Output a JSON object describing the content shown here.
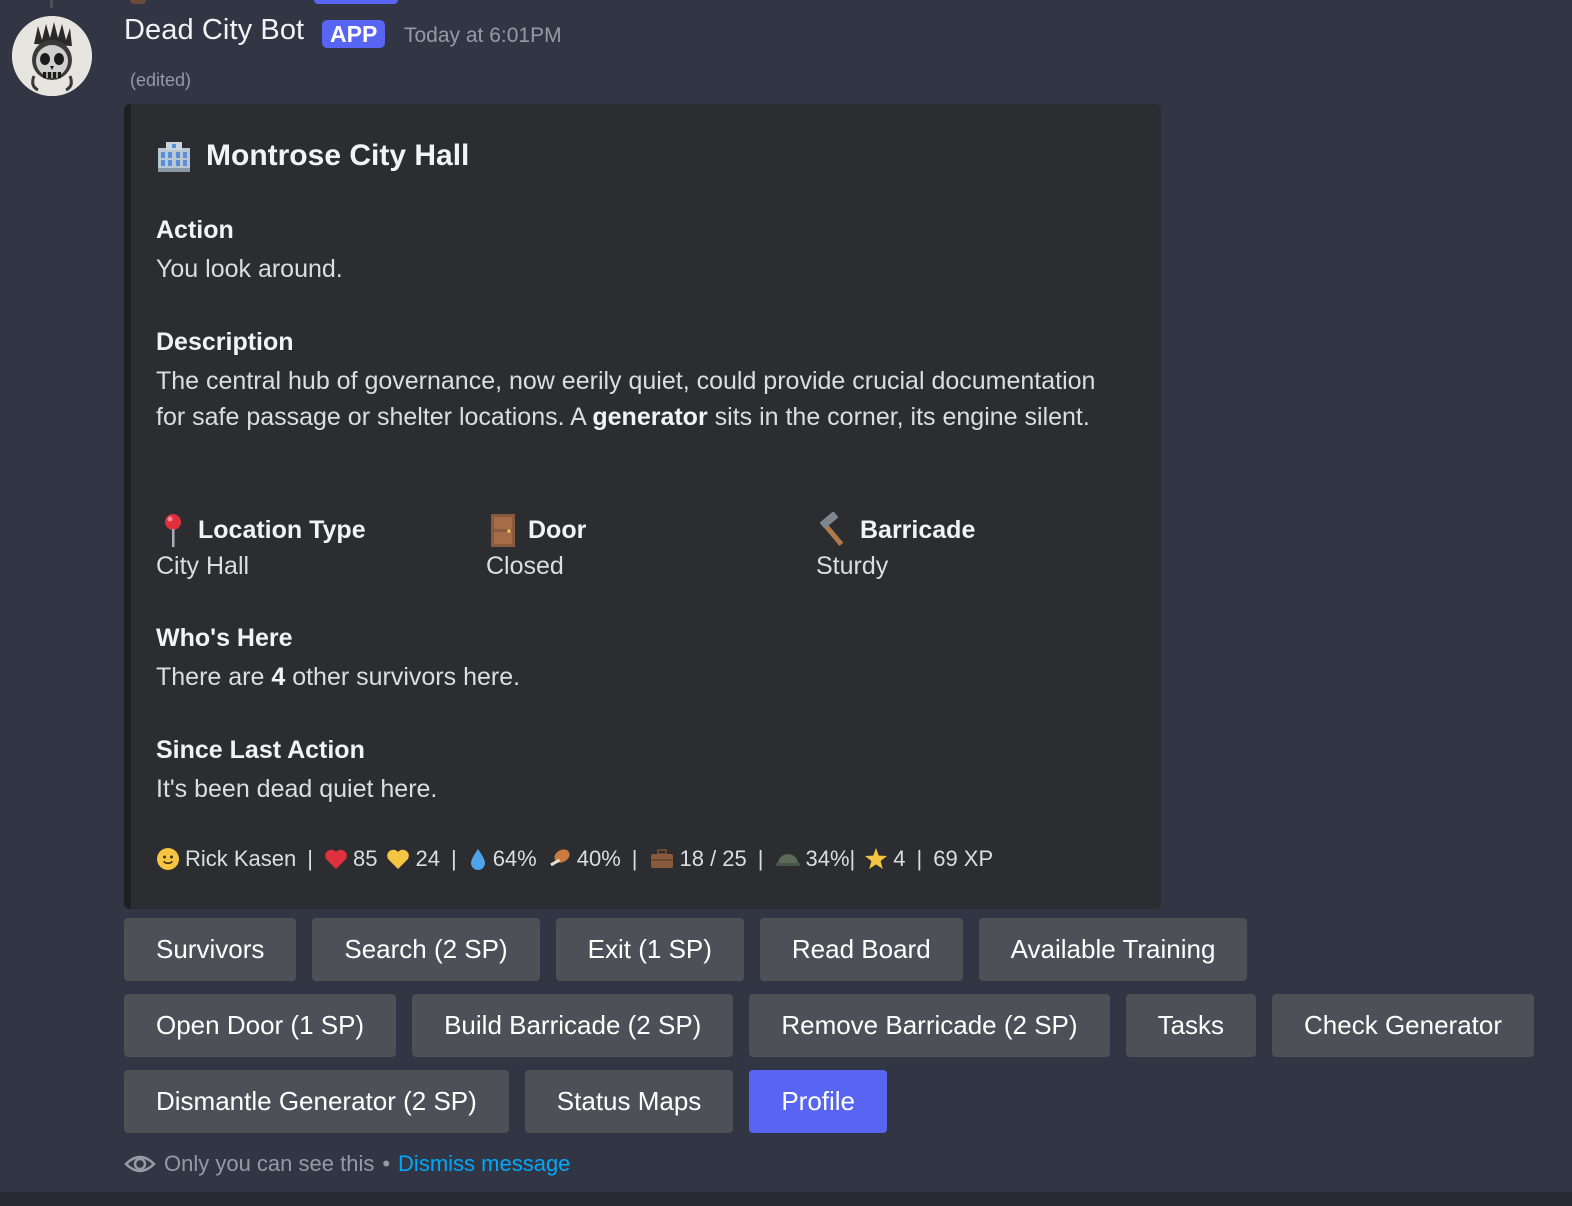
{
  "message": {
    "author": "Dead City Bot",
    "badge": "APP",
    "timestamp": "Today at 6:01PM",
    "edited": "(edited)",
    "avatar_icon": "skull-icon"
  },
  "embed": {
    "title_icon": "city-hall-icon",
    "title": "Montrose City Hall",
    "action": {
      "name": "Action",
      "value": "You look around."
    },
    "description": {
      "name": "Description",
      "before": "The central hub of governance, now eerily quiet, could provide crucial documentation for safe passage or shelter locations. A ",
      "bold": "generator",
      "after": " sits in the corner, its engine silent."
    },
    "location_type": {
      "icon": "pin-icon",
      "name": "Location Type",
      "value": "City Hall"
    },
    "door": {
      "icon": "door-icon",
      "name": "Door",
      "value": "Closed"
    },
    "barricade": {
      "icon": "hammer-icon",
      "name": "Barricade",
      "value": "Sturdy"
    },
    "whos_here": {
      "name": "Who's Here",
      "before": "There are ",
      "bold": "4",
      "after": " other survivors here."
    },
    "since_last_action": {
      "name": "Since Last Action",
      "value": "It's been dead quiet here."
    },
    "footer": {
      "player": "Rick Kasen",
      "hp": "85",
      "ap": "24",
      "water": "64%",
      "food": "40%",
      "inventory": "18 / 25",
      "armor": "34%|",
      "level": "4",
      "xp": "69 XP",
      "separator": "|"
    }
  },
  "buttons": {
    "row1": [
      "Survivors",
      "Search (2 SP)",
      "Exit (1 SP)",
      "Read Board",
      "Available Training"
    ],
    "row2": [
      "Open Door (1 SP)",
      "Build Barricade (2 SP)",
      "Remove Barricade (2 SP)",
      "Tasks",
      "Check Generator"
    ],
    "row3": [
      "Dismantle Generator (2 SP)",
      "Status Maps",
      "Profile"
    ]
  },
  "ephemeral": {
    "icon": "eye-icon",
    "text": "Only you can see this",
    "dot": "•",
    "link": "Dismiss message"
  },
  "colors": {
    "background": "#323543",
    "embed": "#2b2d31",
    "button": "#4e5058",
    "primary": "#5865f2",
    "link": "#00a8fc"
  }
}
